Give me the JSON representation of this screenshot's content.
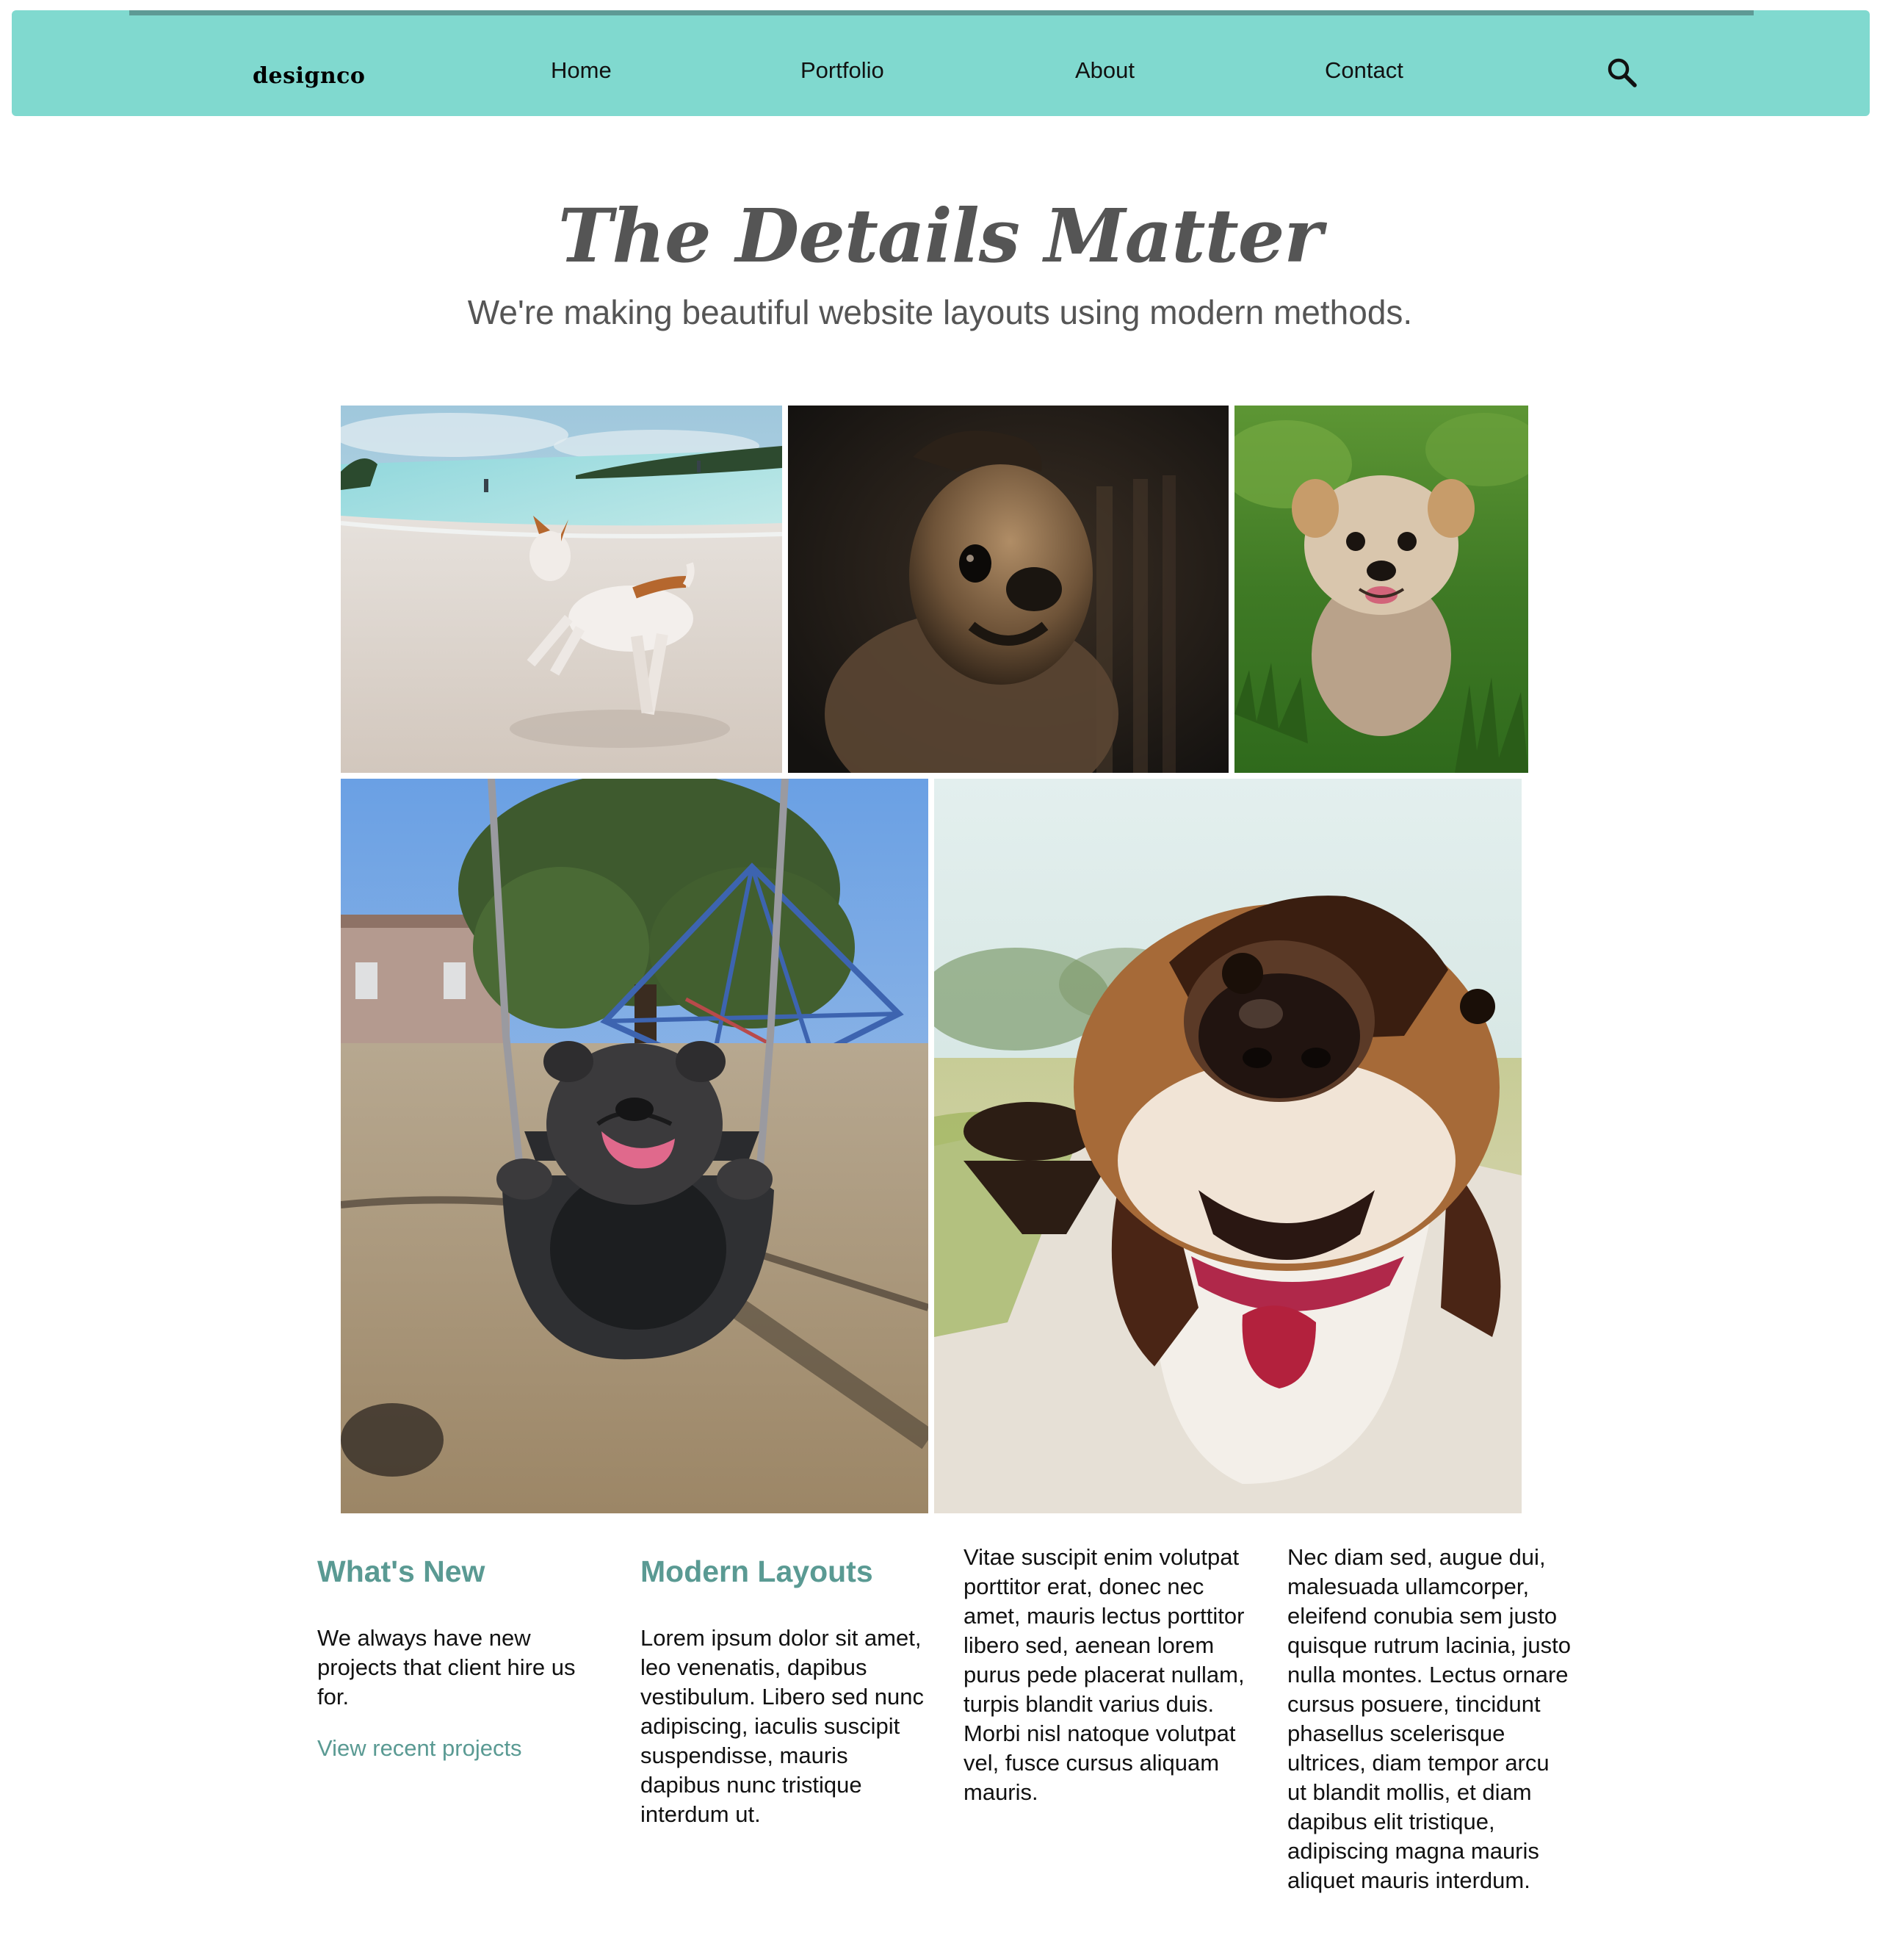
{
  "nav": {
    "logo": "designco",
    "items": [
      {
        "label": "Home"
      },
      {
        "label": "Portfolio"
      },
      {
        "label": "About"
      },
      {
        "label": "Contact"
      }
    ],
    "search_icon": "search-icon"
  },
  "hero": {
    "title": "The Details Matter",
    "subtitle": "We're making beautiful website layouts using modern methods."
  },
  "gallery": {
    "photos": [
      {
        "subject": "dog-running-on-beach"
      },
      {
        "subject": "pug-in-dark-room"
      },
      {
        "subject": "yorkie-on-grass"
      },
      {
        "subject": "french-bulldog-on-swing"
      },
      {
        "subject": "beagle-puppy-closeup"
      }
    ]
  },
  "columns": {
    "whats_new": {
      "heading": "What's New",
      "body": "We always have new projects that client hire us for.",
      "link": "View recent projects"
    },
    "modern_layouts": {
      "heading": "Modern Layouts",
      "body": "Lorem ipsum dolor sit amet, leo venenatis, dapibus vestibulum. Libero sed nunc adipiscing, iaculis suscipit suspendisse, mauris dapibus nunc tristique interdum ut."
    },
    "col3": {
      "body": "Vitae suscipit enim volutpat porttitor erat, donec nec amet, mauris lectus porttitor libero sed, aenean lorem purus pede placerat nullam, turpis blandit varius duis. Morbi nisl natoque volutpat vel, fusce cursus aliquam mauris."
    },
    "col4": {
      "body": "Nec diam sed, augue dui, malesuada ullamcorper, eleifend conubia sem justo quisque rutrum lacinia, justo nulla montes. Lectus ornare cursus posuere, tincidunt phasellus scelerisque ultrices, diam tempor arcu ut blandit mollis, et diam dapibus elit tristique, adipiscing magna mauris aliquet mauris interdum."
    }
  },
  "colors": {
    "nav_bg": "#80d9cf",
    "accent": "#5a9a93",
    "hero_text": "#555555"
  }
}
